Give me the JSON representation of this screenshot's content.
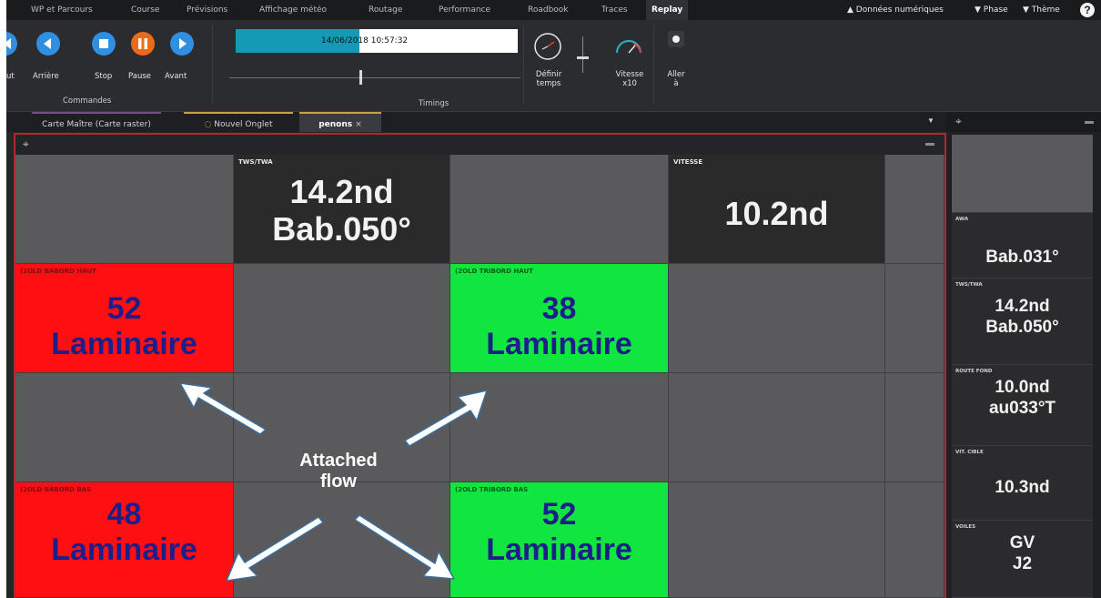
{
  "menu": {
    "items": [
      "WP et Parcours",
      "Course",
      "Prévisions",
      "Affichage météo",
      "Routage",
      "Performance",
      "Roadbook",
      "Traces",
      "Replay"
    ],
    "active": "Replay",
    "right_items": [
      "Données numériques",
      "Phase",
      "Thème"
    ]
  },
  "ribbon": {
    "commands": {
      "group_label": "Commandes",
      "partial_label": "ut",
      "buttons": [
        "Arrière",
        "Stop",
        "Pause",
        "Avant"
      ]
    },
    "timings": {
      "group_label": "Timings",
      "time_display": "14/06/2018 10:57:32",
      "progress": 0.44
    },
    "define_time_label": "Définir temps",
    "speed_label": "Vitesse x10",
    "goto_label": "Aller à"
  },
  "tabs": [
    {
      "label": "Carte Maître (Carte raster)"
    },
    {
      "label": "Nouvel Onglet"
    },
    {
      "label": "penons",
      "close": "×"
    }
  ],
  "panel": {
    "cells": {
      "tws_twa": {
        "label": "TWS/TWA",
        "value": "14.2nd\nBab.050°"
      },
      "vitesse": {
        "label": "VITESSE",
        "value": "10.2nd"
      },
      "babord_haut": {
        "label": "(2OLD BABORD HAUT",
        "value": "52\nLaminaire"
      },
      "tribord_haut": {
        "label": "(2OLD TRIBORD HAUT",
        "value": "38\nLaminaire"
      },
      "babord_bas": {
        "label": "(2OLD BABORD BAS",
        "value": "48\nLaminaire"
      },
      "tribord_bas": {
        "label": "(2OLD TRIBORD BAS",
        "value": "52\nLaminaire"
      }
    },
    "annotation": "Attached\nflow"
  },
  "right_panel": [
    {
      "label": "",
      "value": ""
    },
    {
      "label": "AWA",
      "value": "Bab.031°"
    },
    {
      "label": "TWS/TWA",
      "value": "14.2nd\nBab.050°"
    },
    {
      "label": "ROUTE FOND",
      "value": "10.0nd\nau033°T"
    },
    {
      "label": "VIT. CIBLE",
      "value": "10.3nd"
    },
    {
      "label": "VOILES",
      "value": "GV\nJ2"
    }
  ],
  "colors": {
    "red_cell": "#ff0f12",
    "green_cell": "#10e63f",
    "value_blue": "#1c1f8a",
    "accent_border": "#b5262c",
    "blue_button": "#2f8fe0",
    "orange_button": "#ee6a1a"
  }
}
